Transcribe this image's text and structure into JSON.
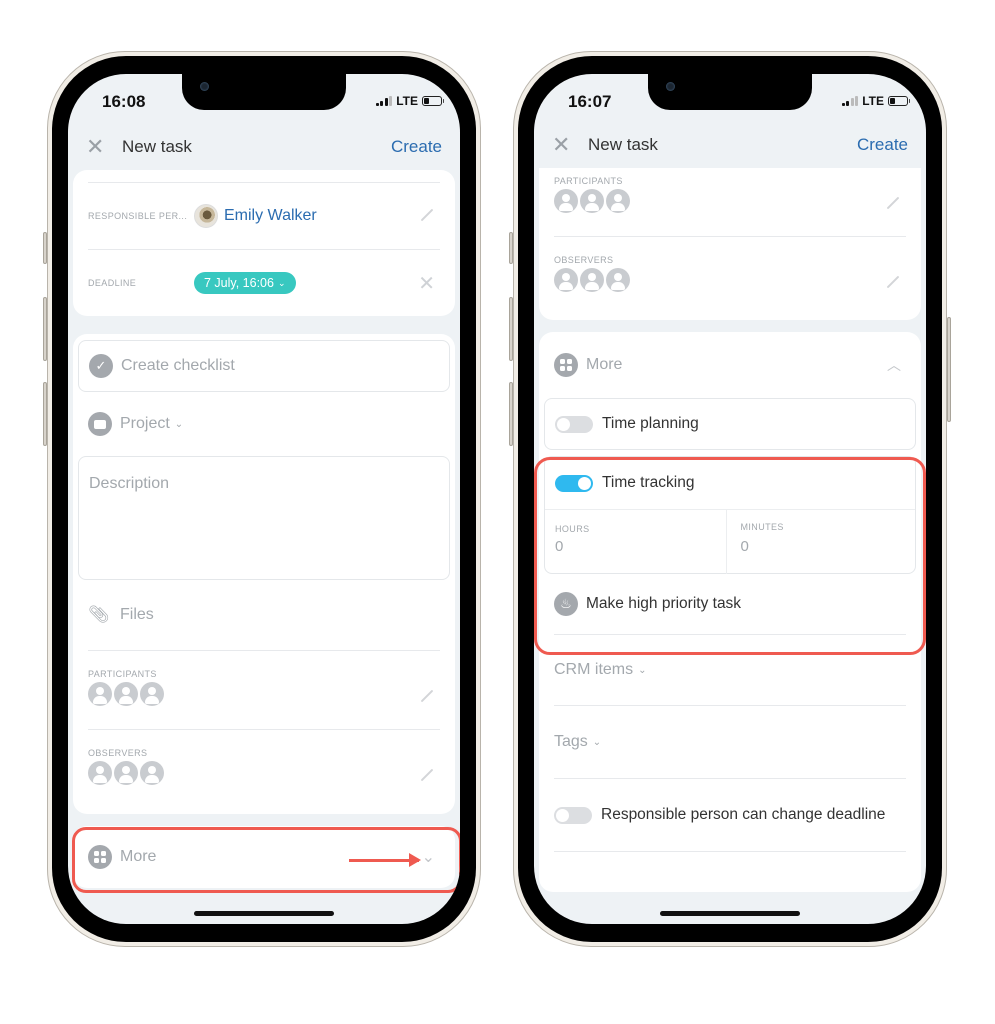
{
  "left_phone": {
    "status": {
      "time": "16:08",
      "network": "LTE"
    },
    "header": {
      "close_icon": "close-icon",
      "title": "New task",
      "create_label": "Create"
    },
    "responsible": {
      "label": "RESPONSIBLE PER...",
      "name": "Emily Walker"
    },
    "deadline": {
      "label": "DEADLINE",
      "value": "7 July, 16:06",
      "chevron": "⌄"
    },
    "checklist_label": "Create checklist",
    "project_label": "Project",
    "description_placeholder": "Description",
    "files_label": "Files",
    "participants_label": "PARTICIPANTS",
    "observers_label": "OBSERVERS",
    "more_label": "More",
    "chevron_down": "⌄",
    "annotation_color": "#ef5a50"
  },
  "right_phone": {
    "status": {
      "time": "16:07",
      "network": "LTE"
    },
    "header": {
      "title": "New task",
      "create_label": "Create"
    },
    "participants_label": "PARTICIPANTS",
    "observers_label": "OBSERVERS",
    "more_label": "More",
    "chevron_up": "︿",
    "time_planning": {
      "label": "Time planning",
      "enabled": false
    },
    "time_tracking": {
      "label": "Time tracking",
      "enabled": true
    },
    "hours": {
      "label": "HOURS",
      "value": "0"
    },
    "minutes": {
      "label": "MINUTES",
      "value": "0"
    },
    "high_priority_label": "Make high priority task",
    "crm_label": "CRM items",
    "tags_label": "Tags",
    "responsible_change_deadline": {
      "label": "Responsible person can change deadline",
      "enabled": false
    },
    "accent_color": "#2fb9ef",
    "annotation_color": "#ef5a50"
  }
}
